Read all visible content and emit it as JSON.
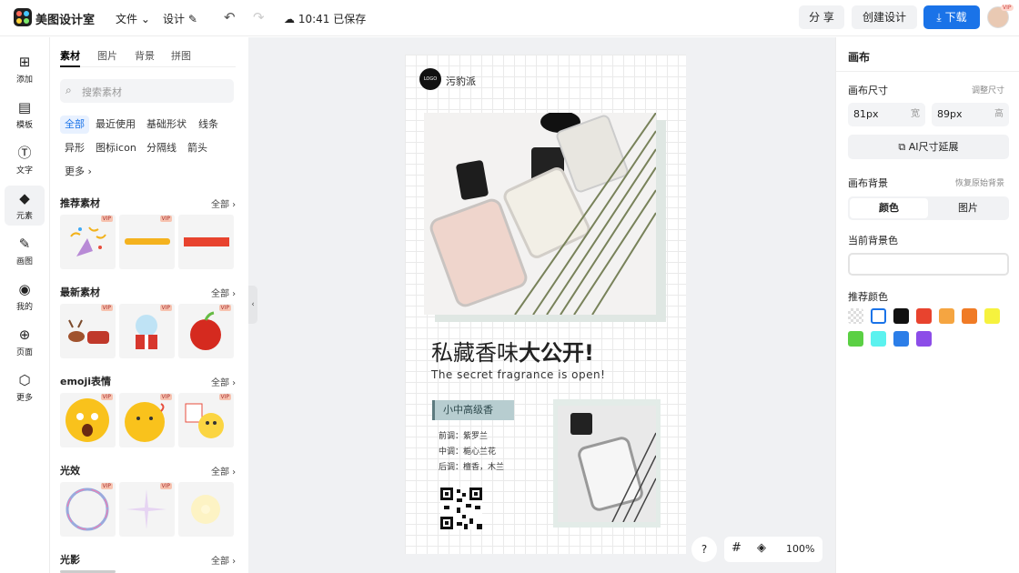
{
  "topbar": {
    "app_name": "美图设计室",
    "file_menu": "文件",
    "design_menu": "设计",
    "save_status": "10:41 已保存",
    "share_label": "分 享",
    "create_label": "创建设计",
    "download_label": "下载"
  },
  "leftrail": [
    {
      "label": "添加",
      "icon": "plus-square-icon"
    },
    {
      "label": "模板",
      "icon": "template-icon"
    },
    {
      "label": "文字",
      "icon": "text-icon"
    },
    {
      "label": "元素",
      "icon": "element-icon"
    },
    {
      "label": "画图",
      "icon": "draw-icon"
    },
    {
      "label": "我的",
      "icon": "user-icon"
    },
    {
      "label": "页面",
      "icon": "page-icon"
    },
    {
      "label": "更多",
      "icon": "cube-icon"
    }
  ],
  "panel": {
    "tabs": [
      "素材",
      "图片",
      "背景",
      "拼图"
    ],
    "search_placeholder": "搜索素材",
    "chips": [
      "全部",
      "最近使用",
      "基础形状",
      "线条",
      "异形",
      "图标icon",
      "分隔线",
      "箭头",
      "更多"
    ],
    "sections": [
      {
        "title": "推荐素材",
        "all": "全部"
      },
      {
        "title": "最新素材",
        "all": "全部"
      },
      {
        "title": "emoji表情",
        "all": "全部"
      },
      {
        "title": "光效",
        "all": "全部"
      },
      {
        "title": "光影",
        "all": "全部"
      }
    ],
    "vip_badge": "VIP"
  },
  "artboard": {
    "logo_text": "LOGO",
    "brand_name": "污豹派",
    "headline_light": "私藏香味",
    "headline_bold": "大公开!",
    "subline": "The secret fragrance is open!",
    "tag": "小中高级香",
    "notes": [
      "前调：紫罗兰",
      "中调：梔心兰花",
      "后调：檀香，木兰"
    ]
  },
  "float": {
    "help": "?",
    "zoom": "100%"
  },
  "rightpanel": {
    "title": "画布",
    "size_label": "画布尺寸",
    "size_link": "调整尺寸",
    "width_value": "81px",
    "width_unit": "宽",
    "height_value": "89px",
    "height_unit": "高",
    "ai_button": "AI尺寸延展",
    "bg_label": "画布背景",
    "bg_link": "恢复原始背景",
    "seg_color": "颜色",
    "seg_image": "图片",
    "current_bg_label": "当前背景色",
    "recommend_label": "推荐颜色",
    "swatches": [
      "transparent",
      "#ffffff",
      "#111111",
      "#e8432e",
      "#f5a541",
      "#f07b26",
      "#f6f23e",
      "#5bd044",
      "#5bf2ef",
      "#2c7ee8",
      "#8c4de8"
    ]
  }
}
